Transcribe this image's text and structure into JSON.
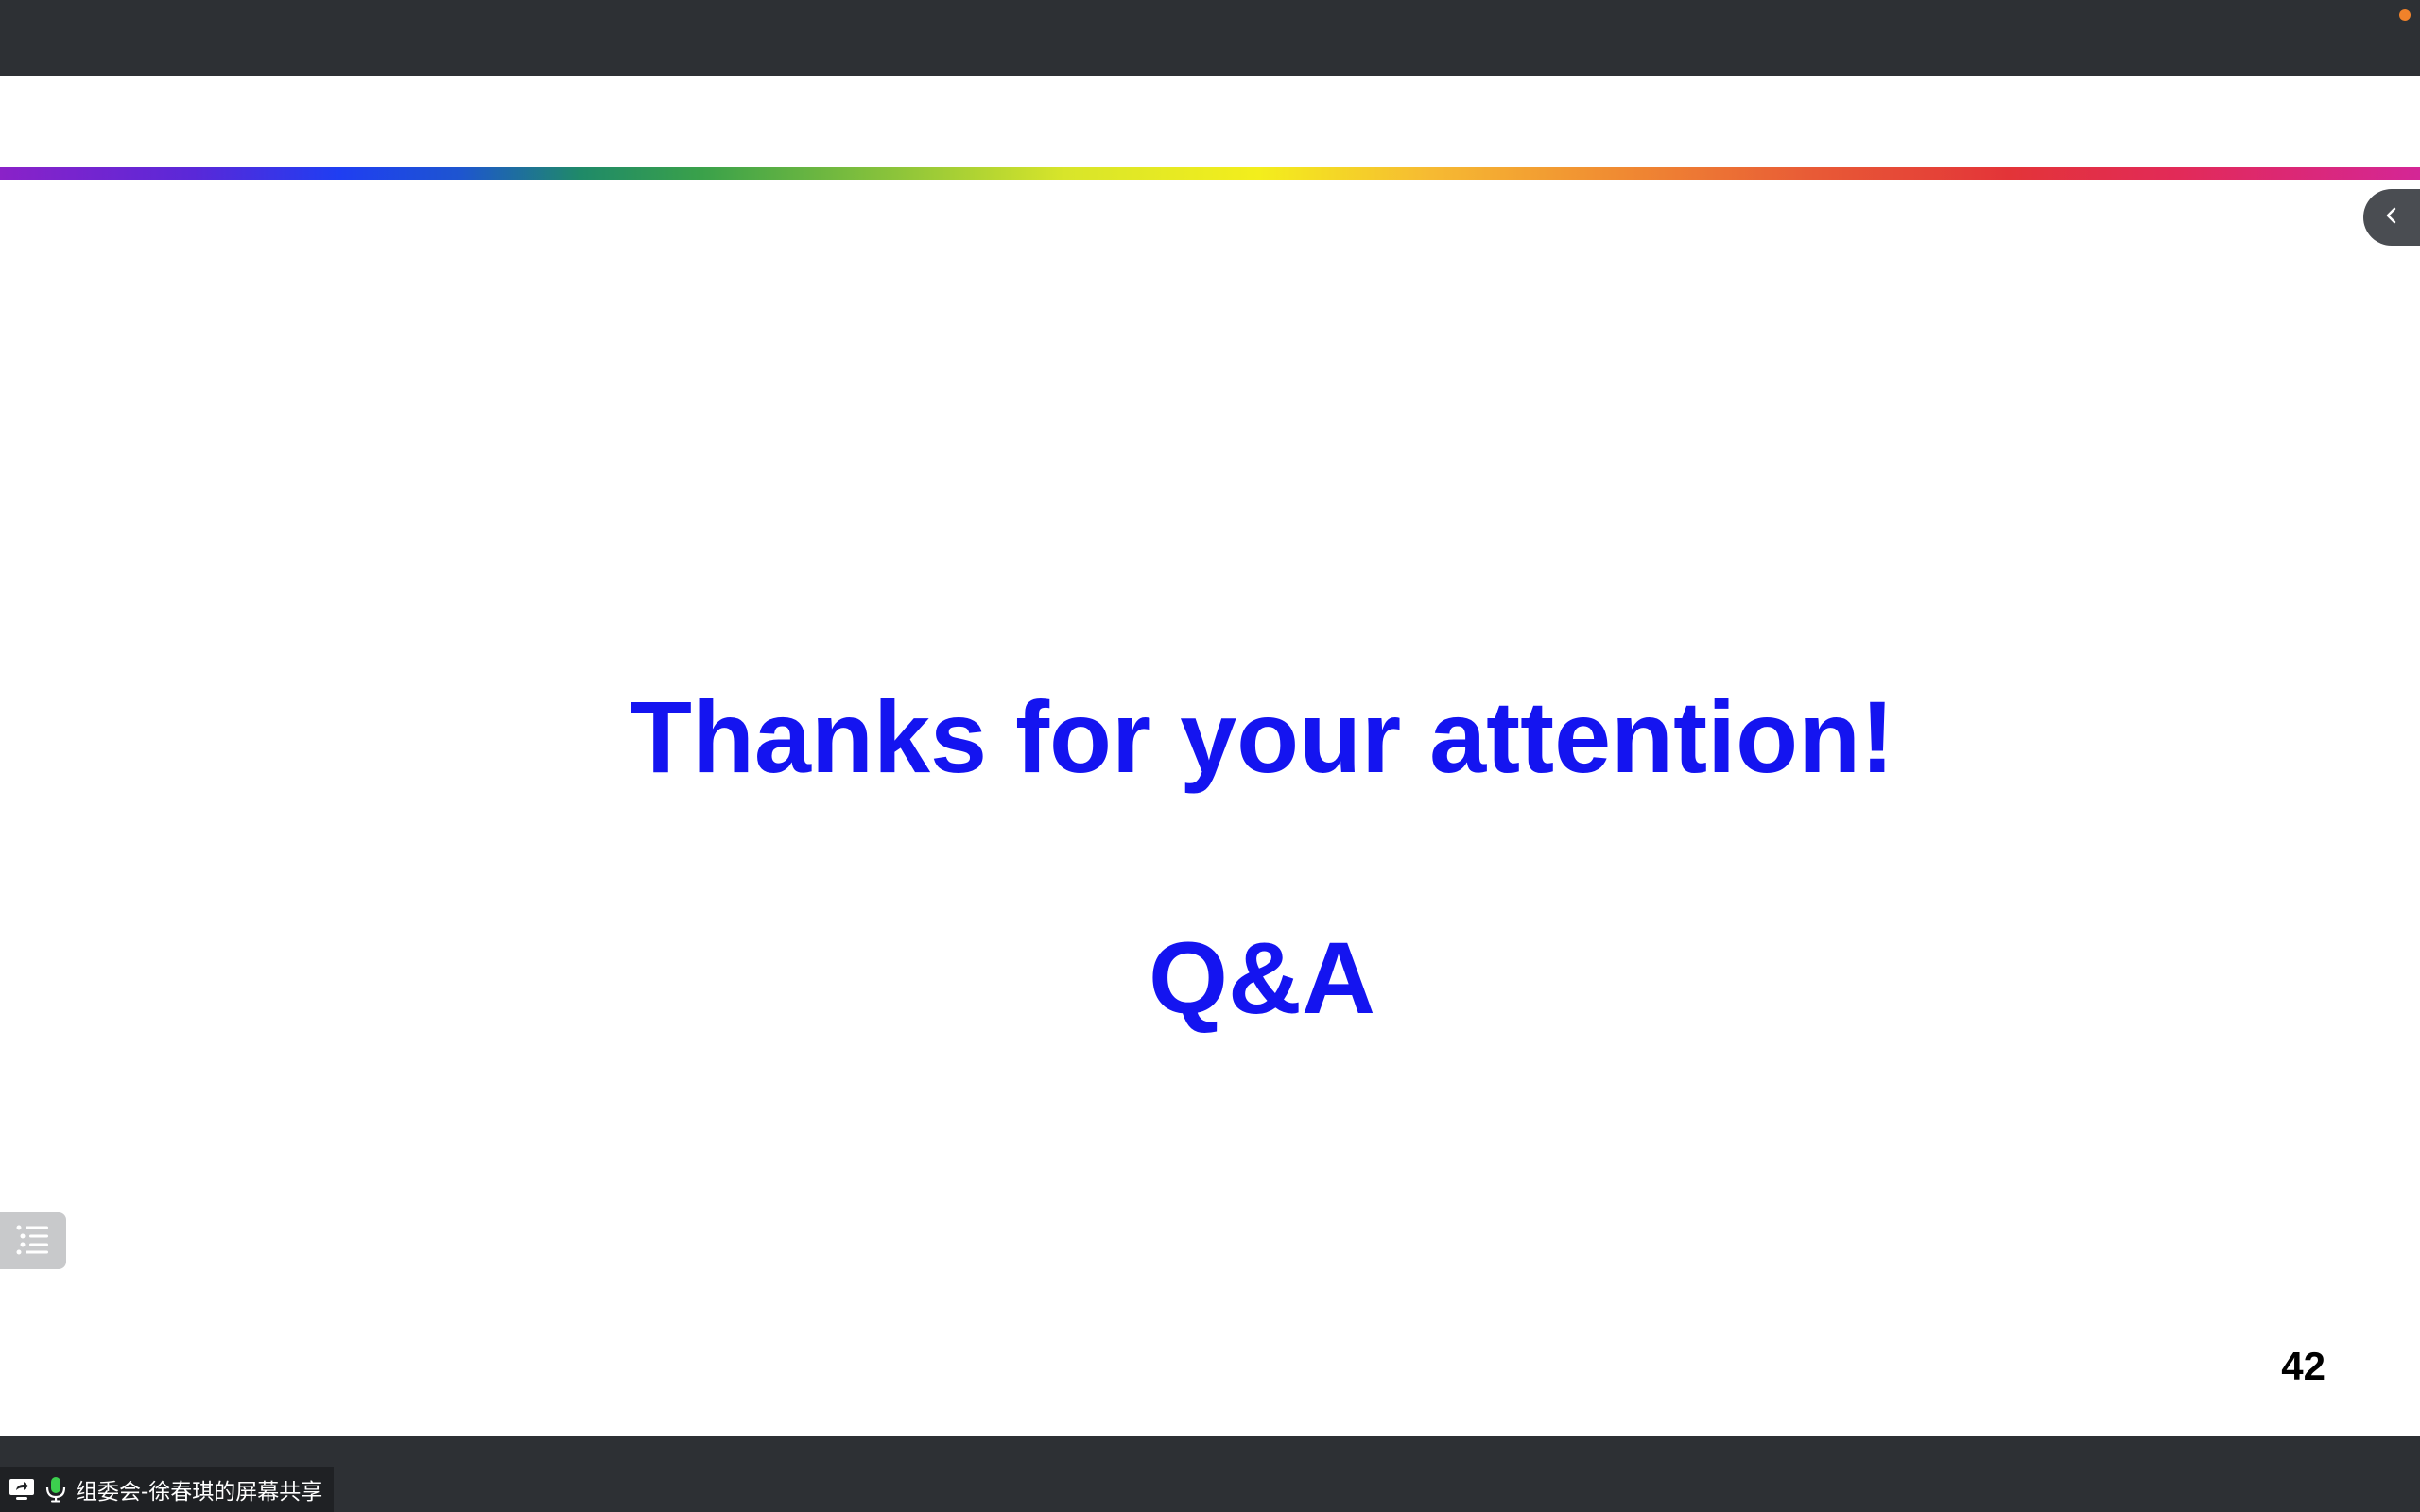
{
  "colors": {
    "chrome_bg": "#2d3034",
    "slide_bg": "#ffffff",
    "title_color": "#1414f0",
    "recording_dot": "#f0822a",
    "mic_active": "#3ccf4e"
  },
  "slide": {
    "title": "Thanks for your attention!",
    "subtitle": "Q&A",
    "page_number": "42"
  },
  "share_indicator": {
    "label": "组委会-徐春琪的屏幕共享",
    "icons": [
      "screen-share-icon",
      "microphone-icon"
    ]
  },
  "controls": {
    "panel_toggle_icon": "chevron-left-icon",
    "outline_icon": "list-icon"
  }
}
